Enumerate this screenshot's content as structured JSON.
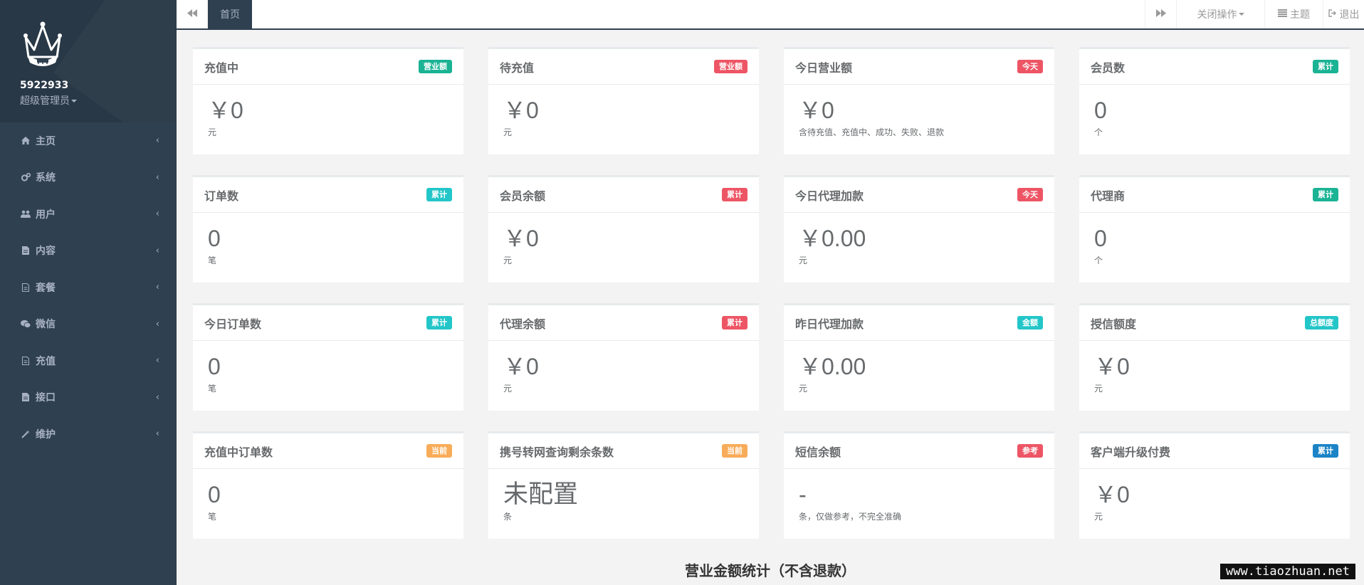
{
  "sidebar": {
    "user_id": "5922933",
    "role": "超级管理员",
    "items": [
      {
        "label": "主页",
        "icon": "home-icon"
      },
      {
        "label": "系统",
        "icon": "cogs-icon"
      },
      {
        "label": "用户",
        "icon": "users-icon"
      },
      {
        "label": "内容",
        "icon": "file-icon"
      },
      {
        "label": "套餐",
        "icon": "file-outline-icon"
      },
      {
        "label": "微信",
        "icon": "wechat-icon"
      },
      {
        "label": "充值",
        "icon": "file-outline-icon"
      },
      {
        "label": "接口",
        "icon": "file-icon"
      },
      {
        "label": "维护",
        "icon": "magic-wand-icon"
      }
    ]
  },
  "topbar": {
    "home_tab": "首页",
    "close_ops": "关闭操作",
    "theme": "主题",
    "logout": "退出"
  },
  "colors": {
    "primary": "#1ab394",
    "info": "#23c6c8",
    "danger": "#ed5565",
    "warning": "#f8ac59",
    "success": "#1c84c6"
  },
  "cards": [
    {
      "title": "充值中",
      "badge": "营业额",
      "badge_color": "#1ab394",
      "value": "￥0",
      "unit": "元"
    },
    {
      "title": "待充值",
      "badge": "营业额",
      "badge_color": "#ed5565",
      "value": "￥0",
      "unit": "元"
    },
    {
      "title": "今日营业额",
      "badge": "今天",
      "badge_color": "#ed5565",
      "value": "￥0",
      "unit": "含待充值、充值中、成功、失败、退款"
    },
    {
      "title": "会员数",
      "badge": "累计",
      "badge_color": "#1ab394",
      "value": "0",
      "unit": "个"
    },
    {
      "title": "订单数",
      "badge": "累计",
      "badge_color": "#23c6c8",
      "value": "0",
      "unit": "笔"
    },
    {
      "title": "会员余额",
      "badge": "累计",
      "badge_color": "#ed5565",
      "value": "￥0",
      "unit": "元"
    },
    {
      "title": "今日代理加款",
      "badge": "今天",
      "badge_color": "#ed5565",
      "value": "￥0.00",
      "unit": "元"
    },
    {
      "title": "代理商",
      "badge": "累计",
      "badge_color": "#1ab394",
      "value": "0",
      "unit": "个"
    },
    {
      "title": "今日订单数",
      "badge": "累计",
      "badge_color": "#23c6c8",
      "value": "0",
      "unit": "笔"
    },
    {
      "title": "代理余额",
      "badge": "累计",
      "badge_color": "#ed5565",
      "value": "￥0",
      "unit": "元"
    },
    {
      "title": "昨日代理加款",
      "badge": "金额",
      "badge_color": "#23c6c8",
      "value": "￥0.00",
      "unit": "元"
    },
    {
      "title": "授信额度",
      "badge": "总额度",
      "badge_color": "#23c6c8",
      "value": "￥0",
      "unit": "元"
    },
    {
      "title": "充值中订单数",
      "badge": "当前",
      "badge_color": "#f8ac59",
      "value": "0",
      "unit": "笔"
    },
    {
      "title": "携号转网查询剩余条数",
      "badge": "当前",
      "badge_color": "#f8ac59",
      "value": "未配置",
      "unit": "条"
    },
    {
      "title": "短信余额",
      "badge": "参考",
      "badge_color": "#ed5565",
      "value": "-",
      "unit": "条，仅做参考，不完全准确"
    },
    {
      "title": "客户端升级付费",
      "badge": "累计",
      "badge_color": "#1c84c6",
      "value": "￥0",
      "unit": "元"
    }
  ],
  "section_title": "营业金额统计（不含退款）",
  "watermark": "www.tiaozhuan.net"
}
